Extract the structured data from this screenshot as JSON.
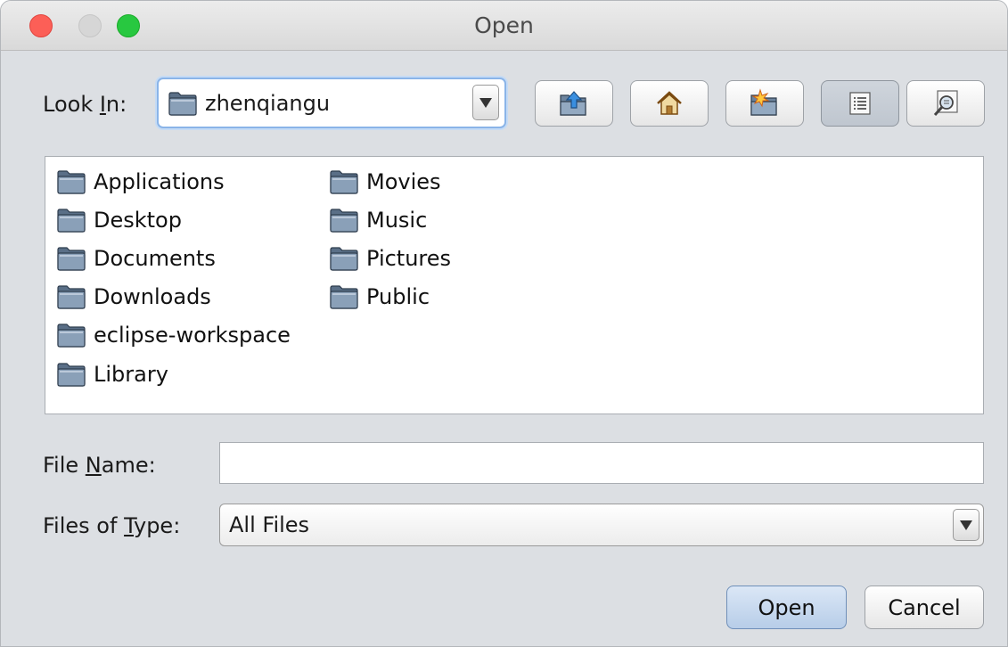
{
  "window": {
    "title": "Open"
  },
  "look_in": {
    "label_pre": "Look ",
    "label_mnemonic": "I",
    "label_post": "n:",
    "value": "zhenqiangu"
  },
  "toolbar": {
    "buttons": [
      {
        "icon": "up-folder-icon"
      },
      {
        "icon": "home-icon"
      },
      {
        "icon": "new-folder-icon"
      },
      {
        "icon": "list-view-icon"
      },
      {
        "icon": "details-view-icon"
      }
    ]
  },
  "files": {
    "column1": [
      "Applications",
      "Desktop",
      "Documents",
      "Downloads",
      "eclipse-workspace",
      "Library"
    ],
    "column2": [
      "Movies",
      "Music",
      "Pictures",
      "Public"
    ]
  },
  "file_name": {
    "label_pre": "File ",
    "label_mnemonic": "N",
    "label_post": "ame:",
    "value": ""
  },
  "file_type": {
    "label_pre": "Files of ",
    "label_mnemonic": "T",
    "label_post": "ype:",
    "value": "All Files"
  },
  "actions": {
    "open_label": "Open",
    "cancel_label": "Cancel"
  },
  "colors": {
    "window_bg": "#dcdfe3",
    "focus_ring": "#8ab4e8",
    "default_button": "#b7cde8",
    "close": "#fc5f57",
    "maximize": "#28c840"
  }
}
